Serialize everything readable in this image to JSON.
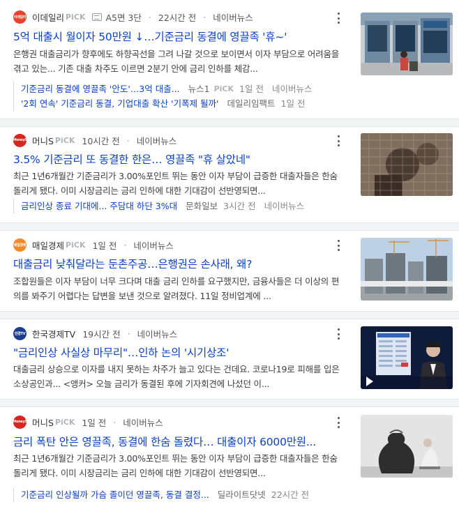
{
  "cards": [
    {
      "press": "이데일리",
      "pick": "PiCK",
      "paper": "A5면 3단",
      "time": "22시간 전",
      "source": "네이버뉴스",
      "title": "5억 대출시 월이자 50만원 ↓…기준금리 동결에 영끌족 '휴~'",
      "desc": "은행권 대출금리가 향후에도 하향곡선을 그려 나갈 것으로 보이면서 이자 부담으로 어려움을 겪고 있는... 기존 대출 차주도 이르면 2분기 안에 금리 인하를 체감...",
      "related": [
        {
          "title": "기준금리 동결에 영끌족 '안도'…3억 대출...",
          "source": "뉴스1",
          "pick": "PiCK",
          "date": "1일 전"
        },
        {
          "title": "'2회 연속' 기준금리 동결, 기업대출 확산 '기폭제 될까'",
          "source": "데일리임팩트",
          "date": "1일 전"
        }
      ]
    },
    {
      "press": "머니S",
      "pick": "PiCK",
      "time": "10시간 전",
      "source": "네이버뉴스",
      "title": "3.5% 기준금리 또 동결한 한은… 영끌족 \"휴 살았네\"",
      "desc": "최근 1년6개월간 기준금리가 3.00%포인트 뛰는 동안 이자 부담이 급증한 대출자들은 한숨 돌리게 됐다. 이미 시장금리는 금리 인하에 대한 기대감이 선반영되면...",
      "related": [
        {
          "title": "금리인상 종료 기대에... 주담대 하단 3%대",
          "source": "문화일보",
          "date": "3시간 전"
        }
      ]
    },
    {
      "press": "매일경제",
      "pick": "PiCK",
      "time": "1일 전",
      "source": "네이버뉴스",
      "title": "대출금리 낮춰달라는 둔촌주공…은행권은 손사래, 왜?",
      "desc": "조합원들은 이자 부담이 너무 크다며 대출 금리 인하를 요구했지만, 금융사들은 더 이상의 편의를 봐주기 어렵다는 답변을 보낸 것으로 알려졌다. 11일 정비업계에 ..."
    },
    {
      "press": "한국경제TV",
      "time": "19시간 전",
      "source": "네이버뉴스",
      "title": "\"금리인상 사실상 마무리\"…인하 논의 '시기상조'",
      "desc": "대출금리 상승으로 이자를 내지 못하는 차주가 늘고 있다는 건데요. 코로나19로 피해를 입은 소상공인과... <앵커> 오늘 금리가 동결된 후에 기자회견에 나섰던 이..."
    },
    {
      "press": "머니S",
      "pick": "PiCK",
      "time": "1일 전",
      "source": "네이버뉴스",
      "title": "금리 폭탄 안은 영끌족, 동결에 한숨 돌렸다… 대출이자 6000만원...",
      "desc": "최근 1년6개월간 기준금리가 3.00%포인트 뛰는 동안 이자 부담이 급증한 대출자들은 한숨 돌리게 됐다. 이미 시장금리는 금리 인하에 대한 기대감이 선반영되면...",
      "related": [
        {
          "title": "기준금리 인상될까 가슴 졸이던 영끌족, 동결 결정...",
          "source": "딜라이트닷넷",
          "date": "22시간 전"
        }
      ]
    }
  ],
  "colors": {
    "link": "#0a3fc7",
    "meta": "#555555",
    "separator": "#f3f4f6"
  },
  "icons": {
    "more": "kebab-icon",
    "paper": "newspaper-icon",
    "play": "play-icon"
  }
}
